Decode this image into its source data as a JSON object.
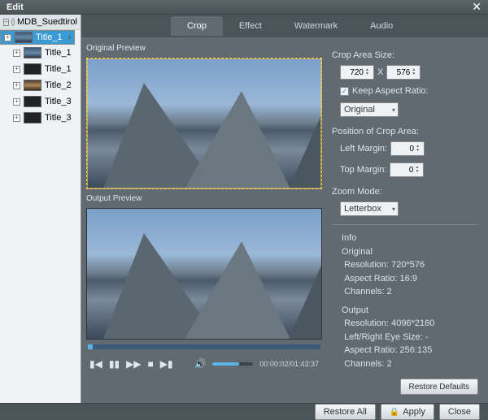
{
  "window": {
    "title": "Edit"
  },
  "sidebar": {
    "root": "MDB_Suedtirol",
    "items": [
      {
        "label": "Title_1",
        "selected": true,
        "thumb": "mtn"
      },
      {
        "label": "Title_1",
        "selected": false,
        "thumb": "mtn"
      },
      {
        "label": "Title_1",
        "selected": false,
        "thumb": "dark"
      },
      {
        "label": "Title_2",
        "selected": false,
        "thumb": "warm"
      },
      {
        "label": "Title_3",
        "selected": false,
        "thumb": "dark"
      },
      {
        "label": "Title_3",
        "selected": false,
        "thumb": "dark"
      }
    ]
  },
  "tabs": {
    "items": [
      "Crop",
      "Effect",
      "Watermark",
      "Audio"
    ],
    "active": 0
  },
  "preview": {
    "original_label": "Original Preview",
    "output_label": "Output Preview",
    "time": "00:00:02/01:43:37"
  },
  "crop": {
    "size_label": "Crop Area Size:",
    "width": "720",
    "x": "X",
    "height": "576",
    "keep_ratio_label": "Keep Aspect Ratio:",
    "keep_ratio_checked": true,
    "ratio_select": "Original",
    "pos_label": "Position of Crop Area:",
    "left_label": "Left Margin:",
    "left": "0",
    "top_label": "Top Margin:",
    "top": "0",
    "zoom_label": "Zoom Mode:",
    "zoom_select": "Letterbox"
  },
  "info": {
    "header": "Info",
    "orig_header": "Original",
    "orig_res_label": "Resolution:",
    "orig_res": "720*576",
    "orig_ar_label": "Aspect Ratio:",
    "orig_ar": "16:9",
    "orig_ch_label": "Channels:",
    "orig_ch": "2",
    "out_header": "Output",
    "out_res_label": "Resolution:",
    "out_res": "4096*2160",
    "out_eye_label": "Left/Right Eye Size:",
    "out_eye": "-",
    "out_ar_label": "Aspect Ratio:",
    "out_ar": "256:135",
    "out_ch_label": "Channels:",
    "out_ch": "2"
  },
  "buttons": {
    "restore_defaults": "Restore Defaults",
    "restore_all": "Restore All",
    "apply": "Apply",
    "close": "Close"
  }
}
